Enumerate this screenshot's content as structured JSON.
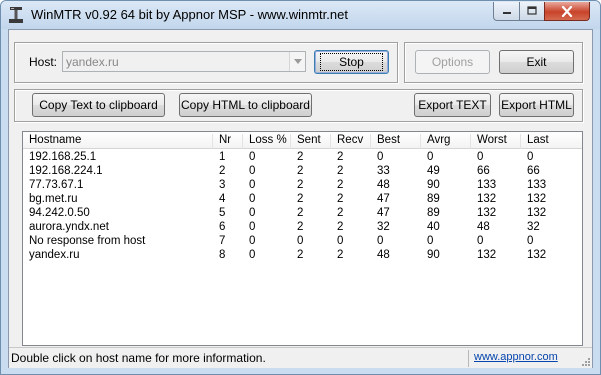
{
  "window": {
    "title": "WinMTR v0.92 64 bit by Appnor MSP - www.winmtr.net"
  },
  "host": {
    "label": "Host:",
    "value": "yandex.ru",
    "stop_label": "Stop",
    "options_label": "Options",
    "exit_label": "Exit"
  },
  "toolbar": {
    "copy_text_label": "Copy Text to clipboard",
    "copy_html_label": "Copy HTML to clipboard",
    "export_text_label": "Export TEXT",
    "export_html_label": "Export HTML"
  },
  "table": {
    "columns": [
      "Hostname",
      "Nr",
      "Loss %",
      "Sent",
      "Recv",
      "Best",
      "Avrg",
      "Worst",
      "Last"
    ],
    "rows": [
      [
        "192.168.25.1",
        "1",
        "0",
        "2",
        "2",
        "0",
        "0",
        "0",
        "0"
      ],
      [
        "192.168.224.1",
        "2",
        "0",
        "2",
        "2",
        "33",
        "49",
        "66",
        "66"
      ],
      [
        "77.73.67.1",
        "3",
        "0",
        "2",
        "2",
        "48",
        "90",
        "133",
        "133"
      ],
      [
        "bg.met.ru",
        "4",
        "0",
        "2",
        "2",
        "47",
        "89",
        "132",
        "132"
      ],
      [
        "94.242.0.50",
        "5",
        "0",
        "2",
        "2",
        "47",
        "89",
        "132",
        "132"
      ],
      [
        "aurora.yndx.net",
        "6",
        "0",
        "2",
        "2",
        "32",
        "40",
        "48",
        "32"
      ],
      [
        "No response from host",
        "7",
        "0",
        "0",
        "0",
        "0",
        "0",
        "0",
        "0"
      ],
      [
        "yandex.ru",
        "8",
        "0",
        "2",
        "2",
        "48",
        "90",
        "132",
        "132"
      ]
    ]
  },
  "status": {
    "message": "Double click on host name for more information.",
    "link": "www.appnor.com"
  },
  "icons": {
    "app": "winmtr-app-icon",
    "minimize": "minimize-icon",
    "maximize": "maximize-icon",
    "close": "close-icon",
    "dropdown": "chevron-down-icon",
    "grip": "resize-grip-icon"
  },
  "colors": {
    "title_bar": "#c9dcf0",
    "close_button": "#c8432a",
    "link": "#0645ad"
  }
}
